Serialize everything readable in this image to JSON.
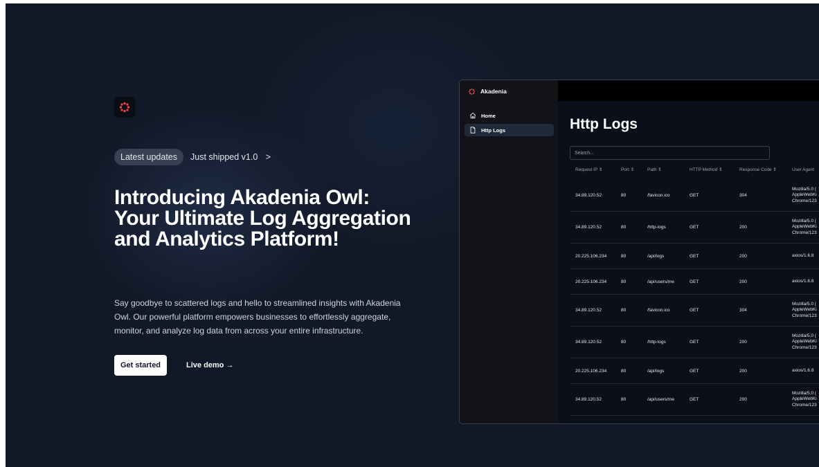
{
  "hero": {
    "badge": "Latest updates",
    "shipped": "Just shipped v1.0",
    "shipped_arrow": ">",
    "headline": "Introducing Akadenia Owl: Your Ultimate Log Aggregation and Analytics Platform!",
    "description": "Say goodbye to scattered logs and hello to streamlined insights with Akadenia Owl. Our powerful platform empowers businesses to effortlessly aggregate, monitor, and analyze log data from across your entire infrastructure.",
    "cta_primary": "Get started",
    "cta_secondary": "Live demo →"
  },
  "app": {
    "brand": "Akadenia",
    "nav": [
      {
        "label": "Home",
        "icon": "home-icon"
      },
      {
        "label": "Http Logs",
        "icon": "document-icon",
        "active": true
      }
    ],
    "title": "Http Logs",
    "search_placeholder": "Search...",
    "columns": [
      "Request IP ⇕",
      "Port ⇕",
      "Path ⇕",
      "HTTP Method ⇕",
      "Response Code ⇕",
      "User Agent"
    ],
    "rows": [
      {
        "ip": "34.89.120.52",
        "port": "80",
        "path": "/favicon.ico",
        "method": "GET",
        "code": "304",
        "ua": "Mozilla/5.0 ( AppleWebKi Chrome/123"
      },
      {
        "ip": "34.89.120.52",
        "port": "80",
        "path": "/http-logs",
        "method": "GET",
        "code": "200",
        "ua": "Mozilla/5.0 ( AppleWebKi Chrome/123"
      },
      {
        "ip": "20.225.106.234",
        "port": "80",
        "path": "/api/logs",
        "method": "GET",
        "code": "200",
        "ua": "axios/1.6.8"
      },
      {
        "ip": "20.225.106.234",
        "port": "80",
        "path": "/api/users/me",
        "method": "GET",
        "code": "200",
        "ua": "axios/1.6.8"
      },
      {
        "ip": "34.89.120.52",
        "port": "80",
        "path": "/favicon.ico",
        "method": "GET",
        "code": "304",
        "ua": "Mozilla/5.0 ( AppleWebKi Chrome/123"
      },
      {
        "ip": "34.89.120.52",
        "port": "80",
        "path": "/http-logs",
        "method": "GET",
        "code": "200",
        "ua": "Mozilla/5.0 ( AppleWebKi Chrome/123"
      },
      {
        "ip": "20.225.106.234",
        "port": "80",
        "path": "/api/logs",
        "method": "GET",
        "code": "200",
        "ua": "axios/1.6.8"
      },
      {
        "ip": "34.89.120.52",
        "port": "80",
        "path": "/api/users/me",
        "method": "GET",
        "code": "200",
        "ua": "Mozilla/5.0 ( AppleWebKi Chrome/123"
      }
    ]
  },
  "colors": {
    "background": "#111827",
    "accent": "#ef4444",
    "text": "#ffffff"
  }
}
